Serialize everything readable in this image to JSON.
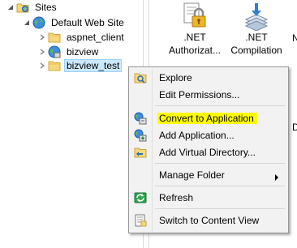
{
  "tree": {
    "sites_label": "Sites",
    "default_site_label": "Default Web Site",
    "children": [
      {
        "label": "aspnet_client"
      },
      {
        "label": "bizview"
      },
      {
        "label": "bizview_test"
      }
    ]
  },
  "features": [
    {
      "label_line1": ".NET",
      "label_line2": "Authorizat..."
    },
    {
      "label_line1": ".NET",
      "label_line2": "Compilation"
    }
  ],
  "right_edge_fragments": {
    "top": "N",
    "bottom": "D"
  },
  "context_menu": {
    "explore": "Explore",
    "edit_permissions": "Edit Permissions...",
    "convert_to_application": "Convert to Application",
    "add_application": "Add Application...",
    "add_virtual_directory": "Add Virtual Directory...",
    "manage_folder": "Manage Folder",
    "refresh": "Refresh",
    "switch_to_content_view": "Switch to Content View",
    "highlight_color": "#ffff00"
  }
}
